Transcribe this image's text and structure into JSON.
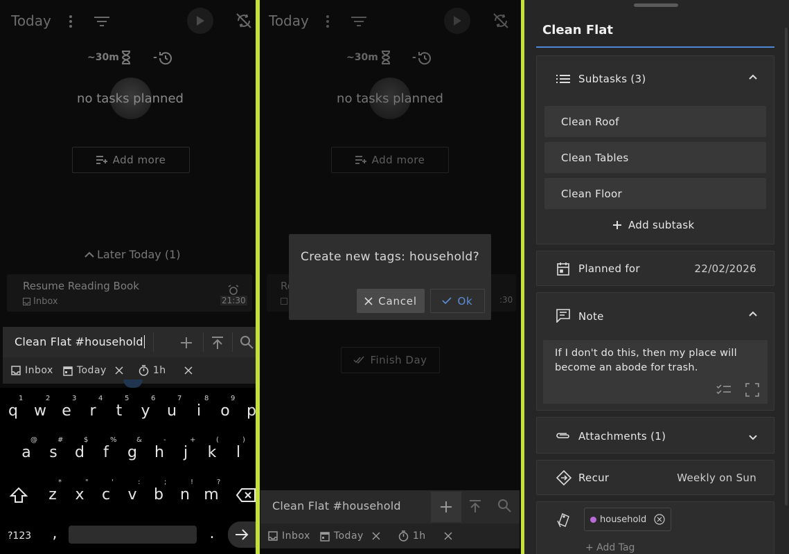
{
  "left": {
    "title": "Today",
    "estimate": "~30m",
    "estimate_minus": "-",
    "no_tasks": "no tasks planned",
    "add_more": "Add more",
    "later_today": "Later Today (1)",
    "task": {
      "title": "Resume Reading Book",
      "project": "Inbox",
      "time": "21:30"
    },
    "input_value": "Clean Flat #household",
    "chips": {
      "project": "Inbox",
      "due": "Today",
      "duration": "1h"
    },
    "keyboard": {
      "row1": [
        "q",
        "w",
        "e",
        "r",
        "t",
        "y",
        "u",
        "i",
        "o",
        "p"
      ],
      "row1_sup": [
        "1",
        "2",
        "3",
        "4",
        "5",
        "6",
        "7",
        "8",
        "9"
      ],
      "row2": [
        "a",
        "s",
        "d",
        "f",
        "g",
        "h",
        "j",
        "k",
        "l"
      ],
      "row2_sup": [
        "@",
        "#",
        "$",
        "%",
        "&",
        "-",
        "+",
        "(",
        ")"
      ],
      "row3": [
        "z",
        "x",
        "c",
        "v",
        "b",
        "n",
        "m"
      ],
      "row3_sup": [
        "*",
        "\"",
        "'",
        ":",
        ";",
        "!",
        "?"
      ],
      "sym": "?123",
      "comma": ",",
      "period": "."
    }
  },
  "middle": {
    "title": "Today",
    "estimate": "~30m",
    "estimate_minus": "-",
    "no_tasks": "no tasks planned",
    "add_more": "Add more",
    "finish_day": "Finish Day",
    "partial_task": "Re",
    "partial_time": ":30",
    "dialog": {
      "message": "Create new tags: household?",
      "cancel": "Cancel",
      "ok": "Ok"
    },
    "input_value": "Clean Flat #household",
    "chips": {
      "project": "Inbox",
      "due": "Today",
      "duration": "1h"
    }
  },
  "detail": {
    "title": "Clean Flat",
    "subtasks_label": "Subtasks (3)",
    "subtasks": [
      "Clean Roof",
      "Clean Tables",
      "Clean Floor"
    ],
    "add_subtask": "Add subtask",
    "planned_label": "Planned for",
    "planned_value": "22/02/2026",
    "note_label": "Note",
    "note_text_1": "If I don't do this, then my place will",
    "note_text_2": "become an abode for trash.",
    "attachments_label": "Attachments (1)",
    "recur_label": "Recur",
    "recur_value": "Weekly on Sun",
    "tag": "household",
    "add_tag": "+ Add Tag"
  },
  "colors": {
    "accent": "#c6e033",
    "ok": "#5b8fd9",
    "tag_dot": "#b86ad6",
    "title_underline": "#4f86d6"
  }
}
